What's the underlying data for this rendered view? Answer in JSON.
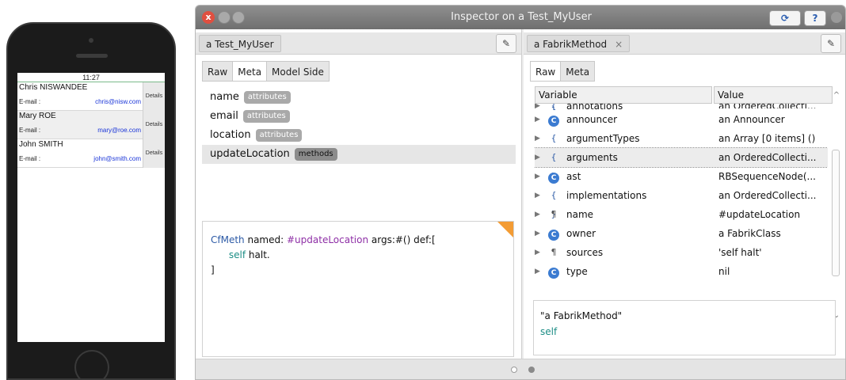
{
  "phone": {
    "time": "11:27",
    "contacts": [
      {
        "name": "Chris NISWANDEE",
        "email_label": "E-mail :",
        "email": "chris@nisw.com",
        "details": "Details"
      },
      {
        "name": "Mary ROE",
        "email_label": "E-mail :",
        "email": "mary@roe.com",
        "details": "Details"
      },
      {
        "name": "John SMITH",
        "email_label": "E-mail :",
        "email": "john@smith.com",
        "details": "Details"
      }
    ]
  },
  "window": {
    "title": "Inspector on a Test_MyUser",
    "close_glyph": "x",
    "refresh_glyph": "⟳",
    "help_glyph": "?"
  },
  "left": {
    "tab": "a Test_MyUser",
    "pencil": "✎",
    "subtabs": [
      "Raw",
      "Meta",
      "Model Side"
    ],
    "active_subtab": "Meta",
    "rows": [
      {
        "name": "name",
        "tag": "attributes"
      },
      {
        "name": "email",
        "tag": "attributes"
      },
      {
        "name": "location",
        "tag": "attributes"
      },
      {
        "name": "updateLocation",
        "tag": "methods"
      }
    ],
    "code": {
      "cls": "CfMeth",
      "p1": " named: ",
      "sym": "#updateLocation",
      "p2": " args:#() def:[",
      "self": "self",
      "p3": " halt.",
      "close": "]"
    }
  },
  "right": {
    "tab": "a FabrikMethod",
    "tab_close": "×",
    "pencil": "✎",
    "subtabs": [
      "Raw",
      "Meta"
    ],
    "active_subtab": "Raw",
    "headers": {
      "variable": "Variable",
      "value": "Value"
    },
    "rows": [
      {
        "arrow": "▶",
        "icon": "{ }",
        "var": "annotations",
        "val": "an OrderedCollecti..."
      },
      {
        "arrow": "▶",
        "icon": "C",
        "var": "announcer",
        "val": "an Announcer"
      },
      {
        "arrow": "▶",
        "icon": "{ }",
        "var": "argumentTypes",
        "val": "an Array [0 items] ()"
      },
      {
        "arrow": "▶",
        "icon": "{ }",
        "var": "arguments",
        "val": "an OrderedCollecti..."
      },
      {
        "arrow": "▶",
        "icon": "C",
        "var": "ast",
        "val": "RBSequenceNode(..."
      },
      {
        "arrow": "▶",
        "icon": "{ }",
        "var": "implementations",
        "val": "an OrderedCollecti..."
      },
      {
        "arrow": "▶",
        "icon": "¶",
        "var": "name",
        "val": "#updateLocation"
      },
      {
        "arrow": "▶",
        "icon": "C",
        "var": "owner",
        "val": "a FabrikClass"
      },
      {
        "arrow": "▶",
        "icon": "¶",
        "var": "sources",
        "val": "'self halt'"
      },
      {
        "arrow": "▶",
        "icon": "C",
        "var": "type",
        "val": "nil"
      }
    ],
    "scroll_up": "^",
    "scroll_down": "⌄",
    "eval": {
      "line1": "\"a FabrikMethod\"",
      "line2": "self"
    }
  }
}
